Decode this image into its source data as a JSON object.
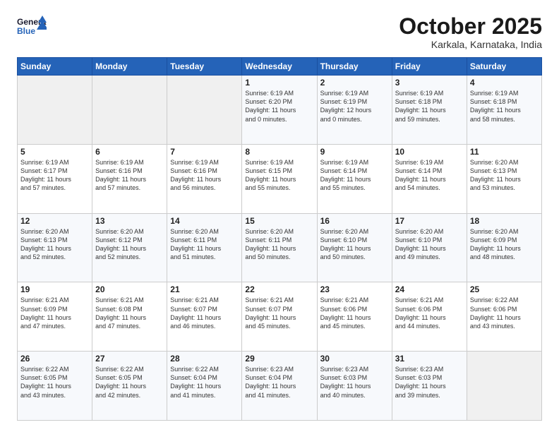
{
  "header": {
    "logo": {
      "line1": "General",
      "line2": "Blue"
    },
    "title": "October 2025",
    "location": "Karkala, Karnataka, India"
  },
  "calendar": {
    "weekdays": [
      "Sunday",
      "Monday",
      "Tuesday",
      "Wednesday",
      "Thursday",
      "Friday",
      "Saturday"
    ],
    "weeks": [
      [
        {
          "day": "",
          "info": ""
        },
        {
          "day": "",
          "info": ""
        },
        {
          "day": "",
          "info": ""
        },
        {
          "day": "1",
          "info": "Sunrise: 6:19 AM\nSunset: 6:20 PM\nDaylight: 11 hours\nand 0 minutes."
        },
        {
          "day": "2",
          "info": "Sunrise: 6:19 AM\nSunset: 6:19 PM\nDaylight: 12 hours\nand 0 minutes."
        },
        {
          "day": "3",
          "info": "Sunrise: 6:19 AM\nSunset: 6:18 PM\nDaylight: 11 hours\nand 59 minutes."
        },
        {
          "day": "4",
          "info": "Sunrise: 6:19 AM\nSunset: 6:18 PM\nDaylight: 11 hours\nand 58 minutes."
        }
      ],
      [
        {
          "day": "5",
          "info": "Sunrise: 6:19 AM\nSunset: 6:17 PM\nDaylight: 11 hours\nand 57 minutes."
        },
        {
          "day": "6",
          "info": "Sunrise: 6:19 AM\nSunset: 6:16 PM\nDaylight: 11 hours\nand 57 minutes."
        },
        {
          "day": "7",
          "info": "Sunrise: 6:19 AM\nSunset: 6:16 PM\nDaylight: 11 hours\nand 56 minutes."
        },
        {
          "day": "8",
          "info": "Sunrise: 6:19 AM\nSunset: 6:15 PM\nDaylight: 11 hours\nand 55 minutes."
        },
        {
          "day": "9",
          "info": "Sunrise: 6:19 AM\nSunset: 6:14 PM\nDaylight: 11 hours\nand 55 minutes."
        },
        {
          "day": "10",
          "info": "Sunrise: 6:19 AM\nSunset: 6:14 PM\nDaylight: 11 hours\nand 54 minutes."
        },
        {
          "day": "11",
          "info": "Sunrise: 6:20 AM\nSunset: 6:13 PM\nDaylight: 11 hours\nand 53 minutes."
        }
      ],
      [
        {
          "day": "12",
          "info": "Sunrise: 6:20 AM\nSunset: 6:13 PM\nDaylight: 11 hours\nand 52 minutes."
        },
        {
          "day": "13",
          "info": "Sunrise: 6:20 AM\nSunset: 6:12 PM\nDaylight: 11 hours\nand 52 minutes."
        },
        {
          "day": "14",
          "info": "Sunrise: 6:20 AM\nSunset: 6:11 PM\nDaylight: 11 hours\nand 51 minutes."
        },
        {
          "day": "15",
          "info": "Sunrise: 6:20 AM\nSunset: 6:11 PM\nDaylight: 11 hours\nand 50 minutes."
        },
        {
          "day": "16",
          "info": "Sunrise: 6:20 AM\nSunset: 6:10 PM\nDaylight: 11 hours\nand 50 minutes."
        },
        {
          "day": "17",
          "info": "Sunrise: 6:20 AM\nSunset: 6:10 PM\nDaylight: 11 hours\nand 49 minutes."
        },
        {
          "day": "18",
          "info": "Sunrise: 6:20 AM\nSunset: 6:09 PM\nDaylight: 11 hours\nand 48 minutes."
        }
      ],
      [
        {
          "day": "19",
          "info": "Sunrise: 6:21 AM\nSunset: 6:09 PM\nDaylight: 11 hours\nand 47 minutes."
        },
        {
          "day": "20",
          "info": "Sunrise: 6:21 AM\nSunset: 6:08 PM\nDaylight: 11 hours\nand 47 minutes."
        },
        {
          "day": "21",
          "info": "Sunrise: 6:21 AM\nSunset: 6:07 PM\nDaylight: 11 hours\nand 46 minutes."
        },
        {
          "day": "22",
          "info": "Sunrise: 6:21 AM\nSunset: 6:07 PM\nDaylight: 11 hours\nand 45 minutes."
        },
        {
          "day": "23",
          "info": "Sunrise: 6:21 AM\nSunset: 6:06 PM\nDaylight: 11 hours\nand 45 minutes."
        },
        {
          "day": "24",
          "info": "Sunrise: 6:21 AM\nSunset: 6:06 PM\nDaylight: 11 hours\nand 44 minutes."
        },
        {
          "day": "25",
          "info": "Sunrise: 6:22 AM\nSunset: 6:06 PM\nDaylight: 11 hours\nand 43 minutes."
        }
      ],
      [
        {
          "day": "26",
          "info": "Sunrise: 6:22 AM\nSunset: 6:05 PM\nDaylight: 11 hours\nand 43 minutes."
        },
        {
          "day": "27",
          "info": "Sunrise: 6:22 AM\nSunset: 6:05 PM\nDaylight: 11 hours\nand 42 minutes."
        },
        {
          "day": "28",
          "info": "Sunrise: 6:22 AM\nSunset: 6:04 PM\nDaylight: 11 hours\nand 41 minutes."
        },
        {
          "day": "29",
          "info": "Sunrise: 6:23 AM\nSunset: 6:04 PM\nDaylight: 11 hours\nand 41 minutes."
        },
        {
          "day": "30",
          "info": "Sunrise: 6:23 AM\nSunset: 6:03 PM\nDaylight: 11 hours\nand 40 minutes."
        },
        {
          "day": "31",
          "info": "Sunrise: 6:23 AM\nSunset: 6:03 PM\nDaylight: 11 hours\nand 39 minutes."
        },
        {
          "day": "",
          "info": ""
        }
      ]
    ]
  }
}
